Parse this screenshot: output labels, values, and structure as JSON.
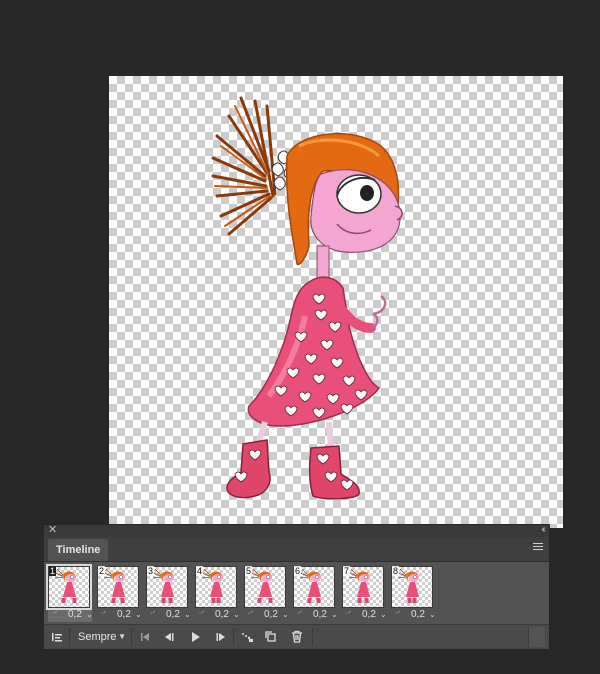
{
  "panel": {
    "title": "Timeline",
    "close_icon": "close-icon",
    "collapse_icon": "collapse-icon",
    "menu_icon": "panel-menu-icon"
  },
  "frames": [
    {
      "number": "1",
      "delay": "0,2",
      "selected": true
    },
    {
      "number": "2",
      "delay": "0,2",
      "selected": false
    },
    {
      "number": "3",
      "delay": "0,2",
      "selected": false
    },
    {
      "number": "4",
      "delay": "0,2",
      "selected": false
    },
    {
      "number": "5",
      "delay": "0,2",
      "selected": false
    },
    {
      "number": "6",
      "delay": "0,2",
      "selected": false
    },
    {
      "number": "7",
      "delay": "0,2",
      "selected": false
    },
    {
      "number": "8",
      "delay": "0,2",
      "selected": false
    }
  ],
  "controls": {
    "loop_value": "Sempre",
    "icons": [
      "convert-timeline-icon",
      "first-frame-icon",
      "previous-frame-icon",
      "play-icon",
      "next-frame-icon",
      "tween-icon",
      "duplicate-frame-icon",
      "delete-frame-icon"
    ]
  },
  "colors": {
    "background": "#282828",
    "panel": "#535353",
    "hair": "#e36a12",
    "dress": "#e8507a",
    "skin": "#f4a6d3"
  }
}
